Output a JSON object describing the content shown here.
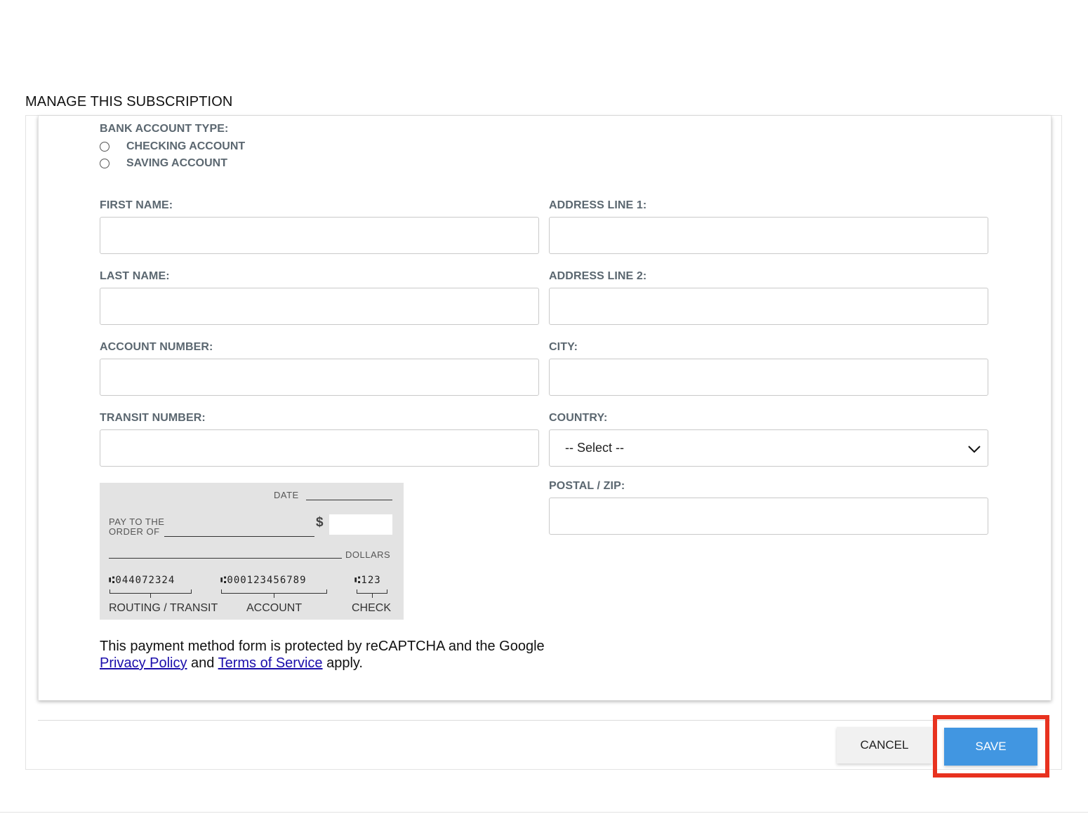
{
  "section": {
    "title": "MANAGE THIS SUBSCRIPTION"
  },
  "bank_account": {
    "label": "BANK ACCOUNT TYPE:",
    "options": [
      {
        "label": "CHECKING ACCOUNT",
        "selected": false
      },
      {
        "label": "SAVING ACCOUNT",
        "selected": false
      }
    ]
  },
  "form": {
    "first_name": {
      "label": "FIRST NAME:",
      "value": ""
    },
    "last_name": {
      "label": "LAST NAME:",
      "value": ""
    },
    "account_number": {
      "label": "ACCOUNT NUMBER:",
      "value": ""
    },
    "transit_number": {
      "label": "TRANSIT NUMBER:",
      "value": ""
    },
    "address_line_1": {
      "label": "ADDRESS LINE 1:",
      "value": ""
    },
    "address_line_2": {
      "label": "ADDRESS LINE 2:",
      "value": ""
    },
    "city": {
      "label": "CITY:",
      "value": ""
    },
    "country": {
      "label": "COUNTRY:",
      "selected": "-- Select --"
    },
    "postal_zip": {
      "label": "POSTAL / ZIP:",
      "value": ""
    }
  },
  "cheque": {
    "date_label": "DATE",
    "pay_to_line1": "PAY TO THE",
    "pay_to_line2": "ORDER OF",
    "dollar_sign": "$",
    "dollars_label": "DOLLARS",
    "routing_micr": "⑆044072324",
    "account_micr": "⑆000123456789",
    "check_micr": "⑆123",
    "routing_caption": "ROUTING / TRANSIT",
    "account_caption": "ACCOUNT",
    "check_caption": "CHECK"
  },
  "recaptcha": {
    "text_before": "This payment method form is protected by reCAPTCHA and the Google",
    "privacy_link": "Privacy Policy",
    "and_text": " and ",
    "terms_link": "Terms of Service",
    "apply_text": " apply."
  },
  "actions": {
    "cancel_label": "CANCEL",
    "save_label": "SAVE"
  },
  "colors": {
    "primary": "#4196e1",
    "highlight": "#e8321f",
    "label": "#5b6770"
  },
  "icons": {
    "country_select": "chevron-down-icon"
  }
}
